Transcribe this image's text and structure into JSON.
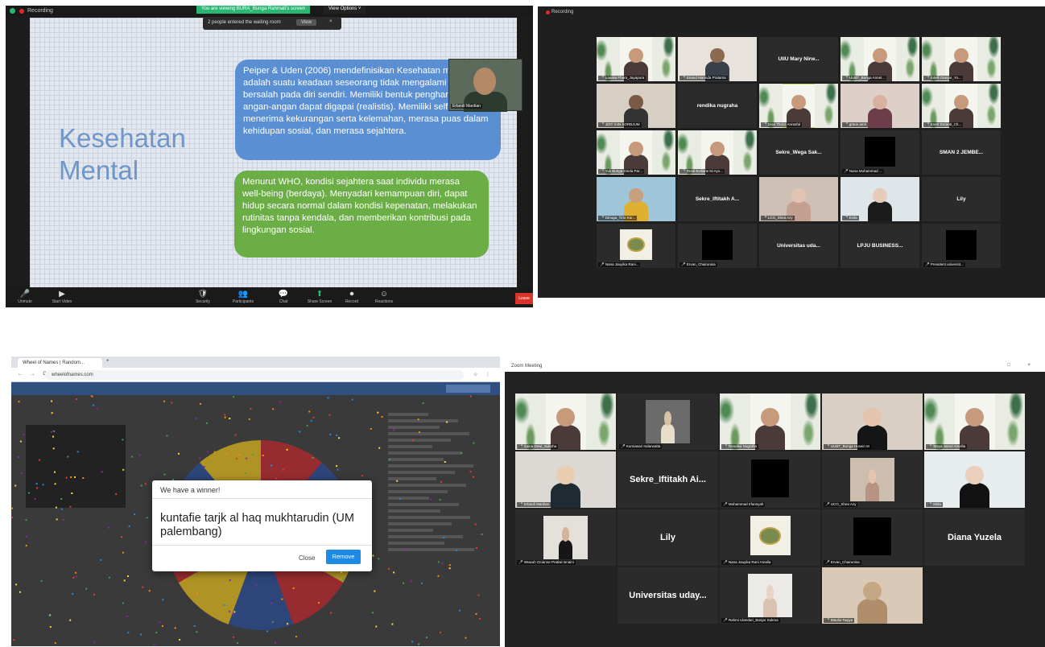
{
  "panel1": {
    "recording_label": "Recording",
    "viewing_banner": "You are viewing BURA_Bunga Rahmati's screen",
    "view_options": "View Options ˅",
    "waiting_notice": "2 people entered the waiting room",
    "waiting_view": "View",
    "waiting_close": "×",
    "slide_title": "Kesehatan Mental",
    "box_blue": "Peiper & Uden (2006) mendefinisikan Kesehatan mental adalah suatu keadaan seseorang tidak mengalami perasaan bersalah pada diri sendiri. Memiliki bentuk pengharapan atau angan-angan dapat digapai (realistis). Memiliki self-efficacy, menerima kekurangan serta kelemahan, merasa puas dalam kehidupan sosial, dan merasa sejahtera.",
    "box_green": "Menurut WHO, kondisi sejahtera saat individu merasa well-being (berdaya). Menyadari kemampuan diri, dapat hidup secara normal dalam kondisi kepenatan, melakukan rutinitas tanpa kendala, dan memberikan kontribusi pada lingkungan sosial.",
    "camera_name": "Erlandi Mardian",
    "toolbar": [
      {
        "icon": "🎤",
        "label": "Unmute"
      },
      {
        "icon": "▶",
        "label": "Start Video"
      },
      {
        "icon": "🛡",
        "label": "Security"
      },
      {
        "icon": "👥",
        "label": "Participants"
      },
      {
        "icon": "💬",
        "label": "Chat"
      },
      {
        "icon": "⬆",
        "label": "Share Screen"
      },
      {
        "icon": "⏺",
        "label": "Record"
      },
      {
        "icon": "☺",
        "label": "Reactions"
      }
    ],
    "leave_label": "Leave"
  },
  "panel2": {
    "recording_label": "Recording",
    "tiles": [
      {
        "kind": "poster",
        "cap": "Lavalia Fhara_Jayapura"
      },
      {
        "kind": "person",
        "cap": "Enand Marinda Pratama",
        "skin": "#8b6a4f",
        "body": "#39404a",
        "bg": "#e7e3dc"
      },
      {
        "kind": "name",
        "text": "UIIU Mary Nirw...",
        "cap": ""
      },
      {
        "kind": "poster",
        "cap": "UUBT_Bunga Annel..."
      },
      {
        "kind": "poster",
        "cap": "Edelli Dianjar_Yo..."
      },
      {
        "kind": "person",
        "cap": "JDIT IAIN SORBJUM",
        "skin": "#7a5a44",
        "body": "#333",
        "bg": "#d7cfc4"
      },
      {
        "kind": "name",
        "text": "rendika nugraha",
        "cap": ""
      },
      {
        "kind": "poster",
        "cap": "Dian Thrizz Anrasfal",
        "sel": true
      },
      {
        "kind": "person",
        "cap": "grace amri",
        "skin": "#d8b2a0",
        "body": "#6e3d4c",
        "bg": "#dcd0c8"
      },
      {
        "kind": "poster",
        "cap": "Evert Doranti_Ch..."
      },
      {
        "kind": "poster",
        "cap": "Yuli Bunga Dinda Par..."
      },
      {
        "kind": "poster",
        "cap": "Resti Eviliane Ni Ayu..."
      },
      {
        "kind": "name",
        "text": "Sekre_Wega Sak...",
        "cap": ""
      },
      {
        "kind": "black",
        "cap": "Nana Muhammad ..."
      },
      {
        "kind": "name",
        "text": "SMAN 2 JEMBE...",
        "cap": ""
      },
      {
        "kind": "person",
        "cap": "Dinuga_Tirto Kar...",
        "skin": "#c7a07e",
        "body": "#e0b030",
        "bg": "#9fc6d8"
      },
      {
        "kind": "name",
        "text": "Sekre_Iftitakh A...",
        "cap": ""
      },
      {
        "kind": "person",
        "cap": "LCO_Shea Azy",
        "skin": "#e2c4b2",
        "body": "#c4a090",
        "bg": "#cfc0b5"
      },
      {
        "kind": "person",
        "cap": "Evila",
        "skin": "#e6ccb8",
        "body": "#1b1b1b",
        "bg": "#dfe6ea"
      },
      {
        "kind": "name",
        "text": "Lily",
        "cap": ""
      },
      {
        "kind": "logo",
        "cap": "Nana Jauyika Rani..."
      },
      {
        "kind": "black",
        "cap": "Ervan_Chairunisa"
      },
      {
        "kind": "name",
        "text": "Universitas uda...",
        "cap": ""
      },
      {
        "kind": "name",
        "text": "LPJU BUSINESS...",
        "cap": ""
      },
      {
        "kind": "black",
        "cap": "President universit..."
      }
    ]
  },
  "panel3": {
    "tab_title": "Wheel of Names | Random...",
    "url": "wheelofnames.com",
    "dialog_title": "We have a winner!",
    "winner": "kuntafie tarjk al haq mukhtarudin (UM palembang)",
    "close_label": "Close",
    "remove_label": "Remove",
    "wheel_colors": [
      "#b7282e",
      "#2a4a8f",
      "#d7b11f",
      "#b7282e",
      "#2a4a8f",
      "#d7b11f",
      "#b7282e",
      "#2a4a8f",
      "#d7b11f"
    ]
  },
  "panel4": {
    "window_title": "Zoom Meeting",
    "tiles": [
      {
        "kind": "poster",
        "cap": "Zaina Dewi_Sukoha"
      },
      {
        "kind": "person",
        "cap": "Kurniasari Indarwatta",
        "skin": "#d8c2a4",
        "body": "#e7ddc9",
        "bg": "#6b6b6b",
        "small": true
      },
      {
        "kind": "poster",
        "cap": "Rendika Nugraha"
      },
      {
        "kind": "person",
        "cap": "UUBT_Bunga Husein M",
        "skin": "#e5c4ad",
        "body": "#151515",
        "bg": "#d9cfc4"
      },
      {
        "kind": "poster",
        "cap": "Tasya Jainul Amallia"
      },
      {
        "kind": "person",
        "cap": "Erlandi Mardian",
        "skin": "#e9cdb0",
        "body": "#202a33",
        "bg": "#dcd9d4",
        "sel": true
      },
      {
        "kind": "name",
        "text": "Sekre_Iftitakh Ai...",
        "cap": ""
      },
      {
        "kind": "black",
        "cap": "Muhammad Irfansyah"
      },
      {
        "kind": "person",
        "cap": "UCO_Shea Azy",
        "skin": "#e4c5b0",
        "body": "#b69383",
        "bg": "#cdbdae",
        "small": true
      },
      {
        "kind": "person",
        "cap": "Shila",
        "skin": "#ebcfbd",
        "body": "#121212",
        "bg": "#e7ecef"
      },
      {
        "kind": "person",
        "cap": "Wuwuh Ocianne Pratiwi Isnaini",
        "skin": "#d1b49a",
        "body": "#161616",
        "bg": "#e4e0da",
        "small": true
      },
      {
        "kind": "name",
        "text": "Lily",
        "cap": ""
      },
      {
        "kind": "logo",
        "cap": "Nana Jauyika Rani Amalia"
      },
      {
        "kind": "black",
        "cap": "Ervan_Chairunisa",
        "small": true
      },
      {
        "kind": "name",
        "text": "Diana Yuzela",
        "cap": ""
      },
      {
        "kind": "empty",
        "cap": ""
      },
      {
        "kind": "name",
        "text": "Universitas uday...",
        "cap": ""
      },
      {
        "kind": "person",
        "cap": "Rahmi Ulandari_Banjar Sukma",
        "skin": "#ead2c4",
        "body": "#d9c2b2",
        "bg": "#eceae6",
        "small": true
      },
      {
        "kind": "person",
        "cap": "Maulia Taqiya",
        "skin": "#c5a784",
        "body": "#b08e6c",
        "bg": "#d9c9b6"
      },
      {
        "kind": "empty",
        "cap": ""
      }
    ]
  }
}
